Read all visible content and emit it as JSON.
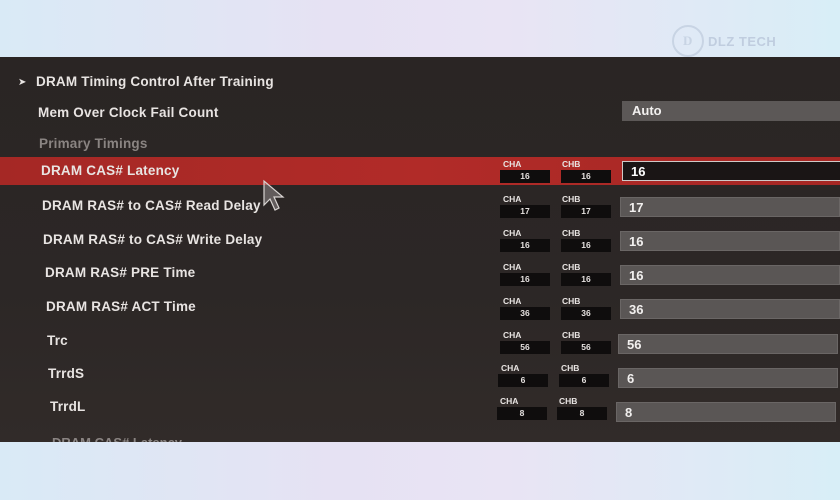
{
  "watermark": {
    "mark": "D",
    "text": "DLZ TECH"
  },
  "menu": {
    "section_title": "DRAM Timing Control After Training",
    "mem_fail_label": "Mem Over Clock Fail Count",
    "mem_fail_value": "Auto",
    "group_label": "Primary Timings"
  },
  "rows": [
    {
      "label": "DRAM CAS# Latency",
      "cha": "16",
      "chb": "16",
      "value": "16"
    },
    {
      "label": "DRAM RAS# to CAS# Read Delay",
      "cha": "17",
      "chb": "17",
      "value": "17"
    },
    {
      "label": "DRAM RAS# to CAS# Write Delay",
      "cha": "16",
      "chb": "16",
      "value": "16"
    },
    {
      "label": "DRAM RAS# PRE Time",
      "cha": "16",
      "chb": "16",
      "value": "16"
    },
    {
      "label": "DRAM RAS# ACT Time",
      "cha": "36",
      "chb": "36",
      "value": "36"
    },
    {
      "label": "Trc",
      "cha": "56",
      "chb": "56",
      "value": "56"
    },
    {
      "label": "TrrdS",
      "cha": "6",
      "chb": "6",
      "value": "6"
    },
    {
      "label": "TrrdL",
      "cha": "8",
      "chb": "8",
      "value": "8"
    }
  ],
  "channel_labels": {
    "a": "CHA",
    "b": "CHB"
  },
  "colors": {
    "highlight": "#b12b28",
    "background": "#2a2524"
  }
}
